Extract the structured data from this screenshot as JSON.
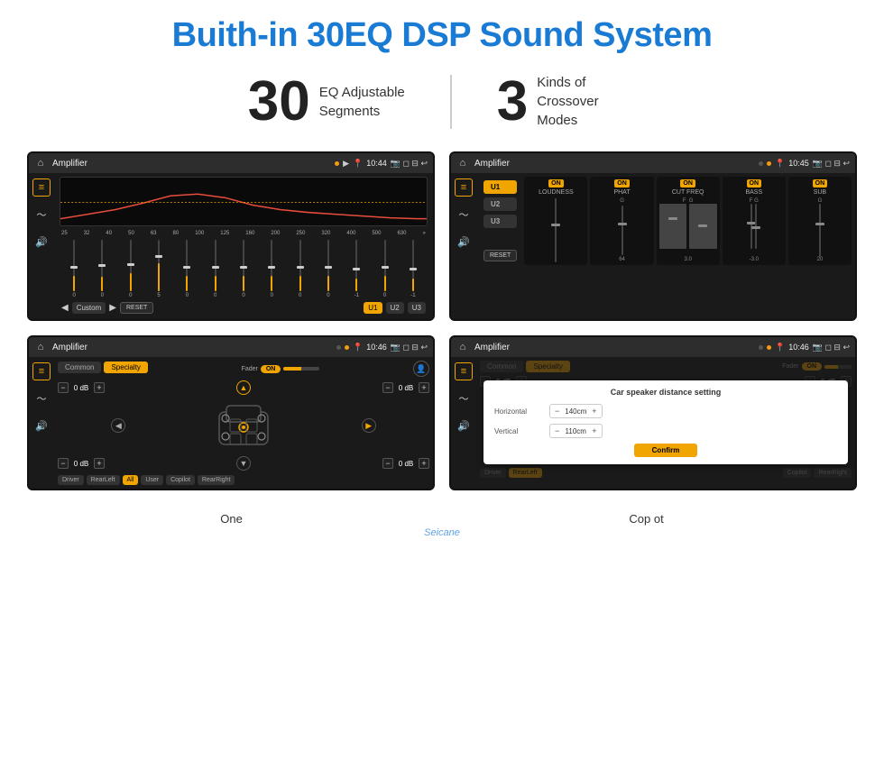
{
  "header": {
    "title": "Buith-in 30EQ DSP Sound System"
  },
  "stats": [
    {
      "number": "30",
      "label": "EQ Adjustable\nSegments"
    },
    {
      "number": "3",
      "label": "Kinds of\nCrossover Modes"
    }
  ],
  "screens": [
    {
      "id": "screen1",
      "time": "10:44",
      "title": "Amplifier",
      "description": "EQ Equalizer screen with 30-band EQ and sliders"
    },
    {
      "id": "screen2",
      "time": "10:45",
      "title": "Amplifier",
      "description": "Crossover screen with U1 U2 U3 bands"
    },
    {
      "id": "screen3",
      "time": "10:46",
      "title": "Amplifier",
      "description": "Fader speaker position screen"
    },
    {
      "id": "screen4",
      "time": "10:46",
      "title": "Amplifier",
      "description": "Car speaker distance setting dialog"
    }
  ],
  "screen1": {
    "eq_freqs": [
      "25",
      "32",
      "40",
      "50",
      "63",
      "80",
      "100",
      "125",
      "160",
      "200",
      "250",
      "320",
      "400",
      "500",
      "630"
    ],
    "bottom_buttons": [
      "Custom",
      "RESET",
      "U1",
      "U2",
      "U3"
    ],
    "values": [
      "0",
      "0",
      "0",
      "5",
      "0",
      "0",
      "0",
      "0",
      "0",
      "0",
      "-1",
      "0",
      "-1"
    ]
  },
  "screen2": {
    "u_buttons": [
      "U1",
      "U2",
      "U3"
    ],
    "col_labels": [
      "LOUDNESS",
      "PHAT",
      "CUT FREQ",
      "BASS",
      "SUB"
    ],
    "reset_label": "RESET"
  },
  "screen3": {
    "tabs": [
      "Common",
      "Specialty"
    ],
    "fader_label": "Fader",
    "fader_on": "ON",
    "positions": [
      "Driver",
      "RearLeft",
      "All",
      "Copilot",
      "RearRight"
    ],
    "db_values": [
      "0 dB",
      "0 dB",
      "0 dB",
      "0 dB"
    ],
    "user_btn": "User"
  },
  "screen4": {
    "dialog_title": "Car speaker distance setting",
    "horizontal_label": "Horizontal",
    "horizontal_value": "140cm",
    "vertical_label": "Vertical",
    "vertical_value": "110cm",
    "confirm_label": "Confirm",
    "tabs": [
      "Common",
      "Specialty"
    ],
    "positions": [
      "Driver",
      "RearLeft",
      "Copilot",
      "RearRight"
    ],
    "db_values": [
      "0 dB",
      "0 dB"
    ]
  },
  "bottom": {
    "label_one": "One",
    "label_copilot": "Cop ot",
    "watermark": "Seicane"
  }
}
